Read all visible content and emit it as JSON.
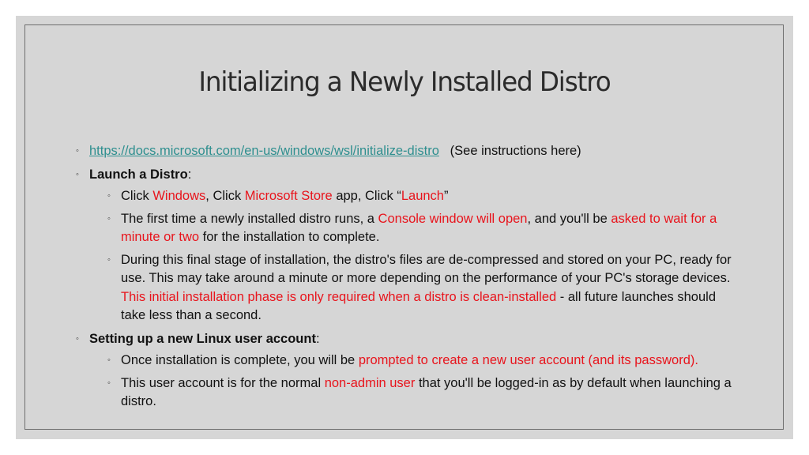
{
  "slide": {
    "title": "Initializing a Newly Installed Distro",
    "colors": {
      "background": "#d6d6d6",
      "text": "#111111",
      "highlight_red": "#e8141c",
      "link": "#2e8f8f"
    },
    "bullet_icon": "circle-bullet",
    "bullets": [
      {
        "link_text": "https://docs.microsoft.com/en-us/windows/wsl/initialize-distro",
        "note": "(See instructions here)"
      },
      {
        "heading": "Launch a Distro",
        "heading_suffix": ":",
        "sub": [
          {
            "segments": [
              {
                "text": "Click ",
                "style": "normal"
              },
              {
                "text": "Windows",
                "style": "red"
              },
              {
                "text": ", Click ",
                "style": "normal"
              },
              {
                "text": "Microsoft Store",
                "style": "red"
              },
              {
                "text": " app, Click “",
                "style": "normal"
              },
              {
                "text": "Launch",
                "style": "red"
              },
              {
                "text": "”",
                "style": "normal"
              }
            ]
          },
          {
            "segments": [
              {
                "text": "The first time a newly installed distro runs, a ",
                "style": "normal"
              },
              {
                "text": "Console window will open",
                "style": "red"
              },
              {
                "text": ", and you'll be ",
                "style": "normal"
              },
              {
                "text": "asked to wait for a minute or two",
                "style": "red"
              },
              {
                "text": " for the installation to complete.",
                "style": "normal"
              }
            ]
          },
          {
            "segments": [
              {
                "text": "During this final stage of installation, the distro's files are de-compressed and stored on your PC, ready for use. This may take around a minute or more depending on the performance of your PC's storage devices. ",
                "style": "normal"
              },
              {
                "text": "This initial installation phase is only required when a distro is clean-installed",
                "style": "red"
              },
              {
                "text": " - all future launches should take less than a second.",
                "style": "normal"
              }
            ]
          }
        ]
      },
      {
        "heading": "Setting up a new Linux user account",
        "heading_suffix": ":",
        "sub": [
          {
            "segments": [
              {
                "text": "Once installation is complete, you will be ",
                "style": "normal"
              },
              {
                "text": "prompted to create a new user account (and its password).",
                "style": "red"
              }
            ]
          },
          {
            "segments": [
              {
                "text": "This user account is for the normal ",
                "style": "normal"
              },
              {
                "text": "non-admin user",
                "style": "red"
              },
              {
                "text": " that you'll be logged-in as by default when launching a distro.",
                "style": "normal"
              }
            ]
          }
        ]
      }
    ]
  }
}
